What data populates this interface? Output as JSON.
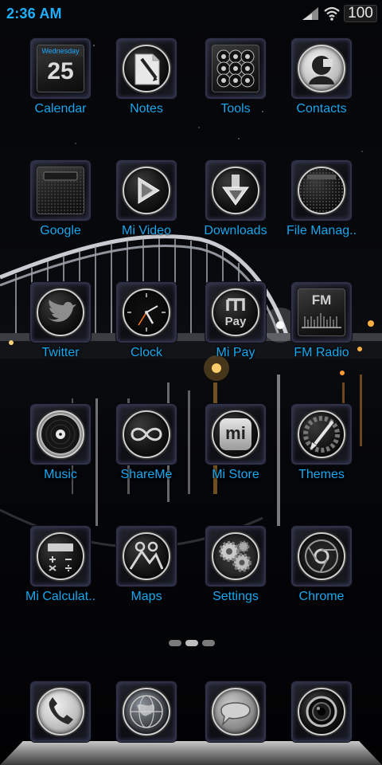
{
  "status_bar": {
    "time": "2:36 AM",
    "battery": "100",
    "icons": [
      "signal-icon",
      "wifi-icon",
      "battery-icon"
    ],
    "time_color": "#1fb0ff"
  },
  "theme": {
    "label_color": "#17a9f2"
  },
  "apps": [
    {
      "label": "Calendar",
      "icon": "calendar-icon",
      "day": "25",
      "weekday": "Wednesday"
    },
    {
      "label": "Notes",
      "icon": "notes-icon"
    },
    {
      "label": "Tools",
      "icon": "tools-icon"
    },
    {
      "label": "Contacts",
      "icon": "contacts-icon"
    },
    {
      "label": "Google",
      "icon": "google-icon"
    },
    {
      "label": "Mi Video",
      "icon": "play-icon"
    },
    {
      "label": "Downloads",
      "icon": "download-icon"
    },
    {
      "label": "File Manag..",
      "icon": "folder-icon"
    },
    {
      "label": "Twitter",
      "icon": "twitter-bird-icon"
    },
    {
      "label": "Clock",
      "icon": "clock-icon"
    },
    {
      "label": "Mi Pay",
      "icon": "mi-pay-icon",
      "logo_text": "Pay"
    },
    {
      "label": "FM Radio",
      "icon": "radio-icon",
      "logo_text": "FM"
    },
    {
      "label": "Music",
      "icon": "music-disc-icon"
    },
    {
      "label": "ShareMe",
      "icon": "shareme-icon"
    },
    {
      "label": "Mi Store",
      "icon": "mi-store-icon",
      "logo_text": "mi"
    },
    {
      "label": "Themes",
      "icon": "themes-brush-icon"
    },
    {
      "label": "Mi Calculat..",
      "icon": "calculator-icon"
    },
    {
      "label": "Maps",
      "icon": "maps-icon"
    },
    {
      "label": "Settings",
      "icon": "gears-icon"
    },
    {
      "label": "Chrome",
      "icon": "chrome-icon"
    }
  ],
  "page_indicator": {
    "pages": 3,
    "current": 2
  },
  "dock": [
    {
      "icon": "phone-icon"
    },
    {
      "icon": "globe-icon"
    },
    {
      "icon": "messaging-icon"
    },
    {
      "icon": "camera-icon"
    }
  ]
}
